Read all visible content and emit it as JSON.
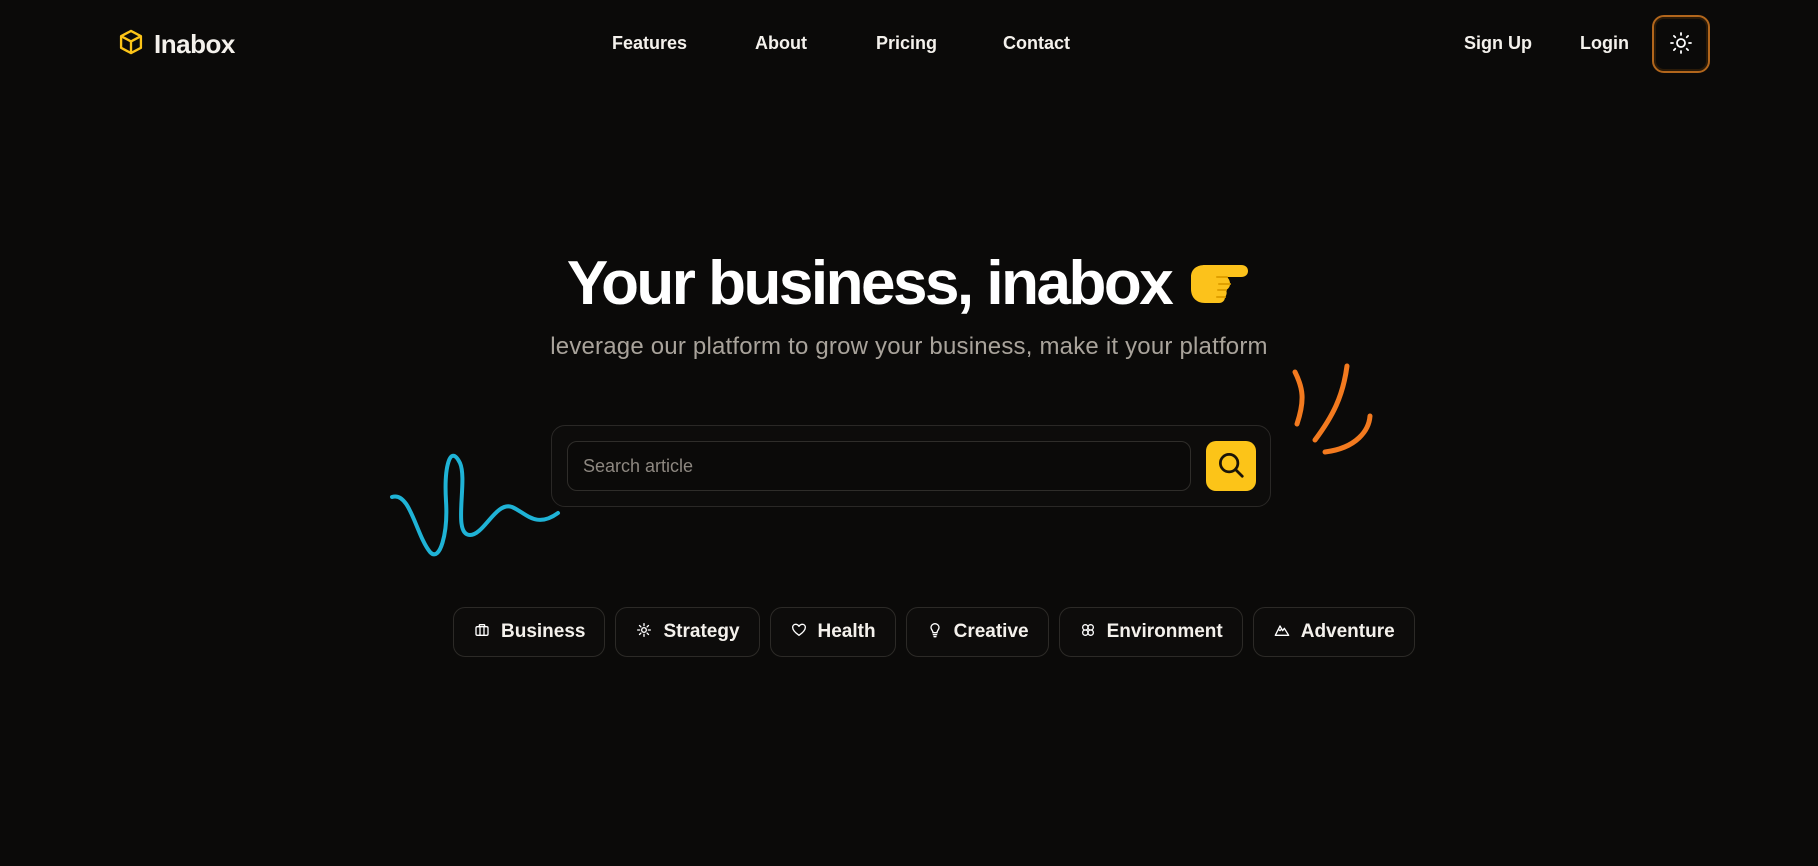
{
  "brand": {
    "name": "Inabox",
    "accent": "#fcc418"
  },
  "nav": {
    "links": [
      "Features",
      "About",
      "Pricing",
      "Contact"
    ],
    "signup_label": "Sign Up",
    "login_label": "Login",
    "theme_icon": "sun-icon"
  },
  "hero": {
    "title": "Your business, inabox",
    "emoji_icon": "pointing-hand-icon",
    "subtitle": "leverage our platform to grow your business, make it your platform"
  },
  "search": {
    "placeholder": "Search article",
    "value": "",
    "button_icon": "search-icon"
  },
  "categories": [
    {
      "label": "Business",
      "icon": "briefcase-icon"
    },
    {
      "label": "Strategy",
      "icon": "gear-icon"
    },
    {
      "label": "Health",
      "icon": "heart-icon"
    },
    {
      "label": "Creative",
      "icon": "lightbulb-icon"
    },
    {
      "label": "Environment",
      "icon": "flower-icon"
    },
    {
      "label": "Adventure",
      "icon": "mountain-icon"
    }
  ],
  "colors": {
    "background": "#0b0a09",
    "squiggle": "#1fb3d6",
    "burst": "#f37a1f",
    "toggle_border": "#b2661c",
    "subtitle": "#a9a39b"
  }
}
